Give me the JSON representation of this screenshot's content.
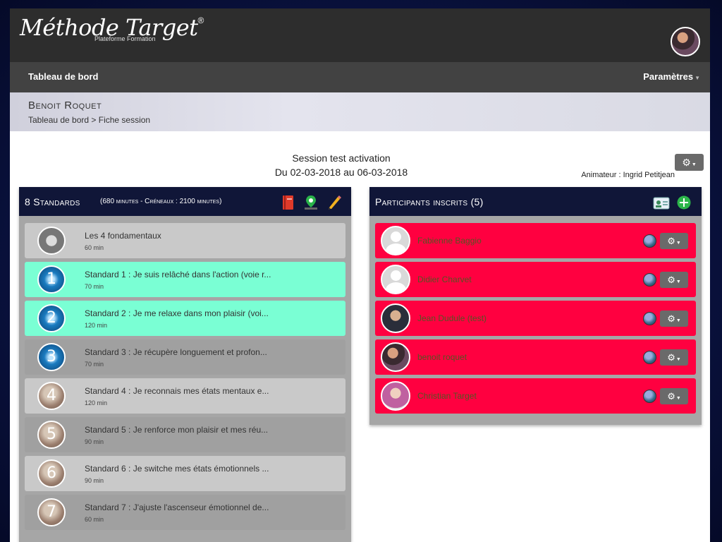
{
  "header": {
    "logo_text": "Méthode Target",
    "logo_mark": "®",
    "logo_subtitle": "Plateforme Formation"
  },
  "nav": {
    "home": "Tableau de bord",
    "settings": "Paramètres"
  },
  "user": {
    "name": "Benoit Roquet",
    "breadcrumb": "Tableau de bord > Fiche session"
  },
  "session": {
    "title": "Session test activation",
    "dates": "Du 02-03-2018 au 06-03-2018",
    "animateur": "Animateur : Ingrid Petitjean"
  },
  "standards_panel": {
    "title": "8 Standards",
    "subtitle": "(680 minutes - Créneaux : 2100 minutes)",
    "items": [
      {
        "badge": "",
        "name": "Les 4 fondamentaux",
        "duration": "60 min"
      },
      {
        "badge": "1",
        "name": "Standard 1 : Je suis relâché dans l'action (voie r...",
        "duration": "70 min"
      },
      {
        "badge": "2",
        "name": "Standard 2 : Je me relaxe dans mon plaisir (voi...",
        "duration": "120 min"
      },
      {
        "badge": "3",
        "name": "Standard 3 : Je récupère longuement et profon...",
        "duration": "70 min"
      },
      {
        "badge": "4",
        "name": "Standard 4 : Je reconnais mes états mentaux e...",
        "duration": "120 min"
      },
      {
        "badge": "5",
        "name": "Standard 5 : Je renforce mon plaisir et mes réu...",
        "duration": "90 min"
      },
      {
        "badge": "6",
        "name": "Standard 6 : Je switche mes états émotionnels ...",
        "duration": "90 min"
      },
      {
        "badge": "7",
        "name": "Standard 7 : J'ajuste l'ascenseur émotionnel de...",
        "duration": "60 min"
      }
    ]
  },
  "participants_panel": {
    "title": "Participants inscrits (5)",
    "items": [
      {
        "name": "Fabienne Baggio"
      },
      {
        "name": "Didier Charvet"
      },
      {
        "name": "Jean Dudule (test)"
      },
      {
        "name": "benoit roquet"
      },
      {
        "name": "Christian Target"
      }
    ]
  },
  "colors": {
    "active_item": "#7affd4",
    "participant_item": "#ff0040",
    "panel_header": "#101638"
  },
  "icons": {
    "book": "book-icon",
    "map": "map-pin-icon",
    "pencil": "pencil-icon",
    "id_card": "id-card-icon",
    "add": "plus-circle-icon",
    "gear": "gear-icon"
  }
}
